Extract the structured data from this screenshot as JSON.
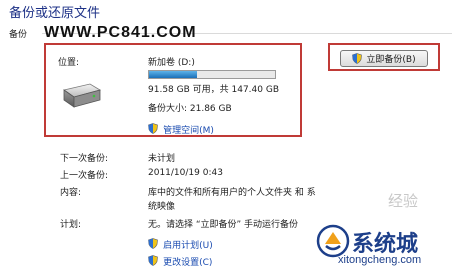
{
  "header": {
    "title": "备份或还原文件",
    "section_label": "备份",
    "watermark_site": "WWW.PC841.COM"
  },
  "location": {
    "label": "位置:",
    "drive_name": "新加卷 (D:)",
    "usage_fraction": 0.38,
    "space_text": "91.58 GB 可用，共 147.40 GB",
    "backup_size": "备份大小: 21.86 GB",
    "manage_space_link": "管理空间(M)"
  },
  "actions": {
    "backup_now_label": "立即备份(B)"
  },
  "details": {
    "next_backup_label": "下一次备份:",
    "next_backup_value": "未计划",
    "last_backup_label": "上一次备份:",
    "last_backup_value": "2011/10/19 0:43",
    "contents_label": "内容:",
    "contents_line1": "库中的文件和所有用户的个人文件夹 和 系",
    "contents_line2": "统映像",
    "schedule_label": "计划:",
    "schedule_value": "无。请选择 “立即备份” 手动运行备份",
    "enable_schedule_link": "启用计划(U)",
    "change_settings_link": "更改设置(C)"
  },
  "watermark": {
    "right_text": "经验",
    "logo_text": "系统城",
    "logo_url": "xitongcheng.com"
  },
  "colors": {
    "title_blue": "#1e3287",
    "link_blue": "#1a4bb0",
    "highlight_red": "#c03a36",
    "progress_blue": "#1a6fb8"
  }
}
